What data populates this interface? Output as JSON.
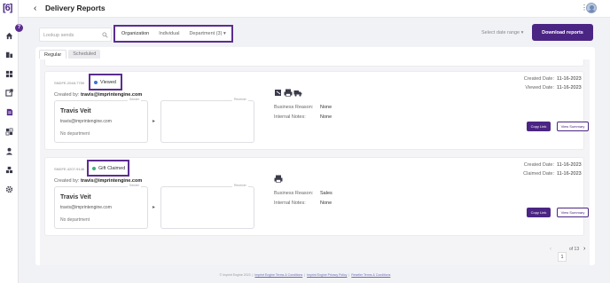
{
  "app": {
    "logo_text": "[6]",
    "help_badge": "?"
  },
  "header": {
    "back_glyph": "‹",
    "title": "Delivery Reports",
    "kebab_glyph": "⋮"
  },
  "sidebar": {
    "items": [
      {
        "icon": "home-icon"
      },
      {
        "icon": "gift-icon"
      },
      {
        "icon": "grid-icon"
      },
      {
        "icon": "export-icon"
      },
      {
        "icon": "reports-icon",
        "active": true
      },
      {
        "icon": "puzzle-icon"
      },
      {
        "icon": "user-icon"
      },
      {
        "icon": "inventory-icon"
      },
      {
        "icon": "settings-icon"
      }
    ]
  },
  "filters": {
    "search_placeholder": "Lookup sends",
    "tabs": [
      "Organization",
      "Individual",
      "Department (3) ▾"
    ],
    "date_range": "Select date range ▾",
    "download_label": "Download reports"
  },
  "subtabs": [
    "Regular",
    "Scheduled"
  ],
  "sends": [
    {
      "send_id": "SNDFE-2048-7759",
      "status": "Viewed",
      "status_color": "#3b74c9",
      "created_by_label": "Created by:",
      "created_by_email": "travis@imprintengine.com",
      "sender_label": "Sender",
      "receiver_label": "Receiver",
      "sender_name": "Travis Veit",
      "sender_email": "travis@imprintengine.com",
      "sender_dept": "No department",
      "business_reason_label": "Business Reason:",
      "business_reason": "None",
      "internal_notes_label": "Internal Notes:",
      "internal_notes": "None",
      "date1_label": "Created Date:",
      "date1_value": "11-16-2023",
      "date2_label": "Viewed Date:",
      "date2_value": "11-16-2023",
      "copy_label": "Copy Link",
      "summary_label": "View Summary"
    },
    {
      "send_id": "SNDFE-4207-9146",
      "status": "Gift Claimed",
      "status_color": "#3bb07a",
      "created_by_label": "Created by:",
      "created_by_email": "travis@imprintengine.com",
      "sender_label": "Sender",
      "receiver_label": "Receiver",
      "sender_name": "Travis Veit",
      "sender_email": "travis@imprintengine.com",
      "sender_dept": "No department",
      "business_reason_label": "Business Reason:",
      "business_reason": "Sales",
      "internal_notes_label": "Internal Notes:",
      "internal_notes": "None",
      "date1_label": "Created Date:",
      "date1_value": "11-16-2023",
      "date2_label": "Claimed Date:",
      "date2_value": "11-16-2023",
      "copy_label": "Copy Link",
      "summary_label": "View Summary"
    }
  ],
  "pagination": {
    "prev_glyph": "‹",
    "current": "1",
    "of_text": "of 13",
    "next_glyph": "›"
  },
  "footer": {
    "copyright": "© Imprint Engine 2023",
    "links": [
      "Imprint Engine Terms & Conditions",
      "Imprint Engine Privacy Policy",
      "Reseller Terms & Conditions"
    ]
  },
  "colors": {
    "brand": "#4b2583",
    "highlight": "#5b2d90"
  }
}
